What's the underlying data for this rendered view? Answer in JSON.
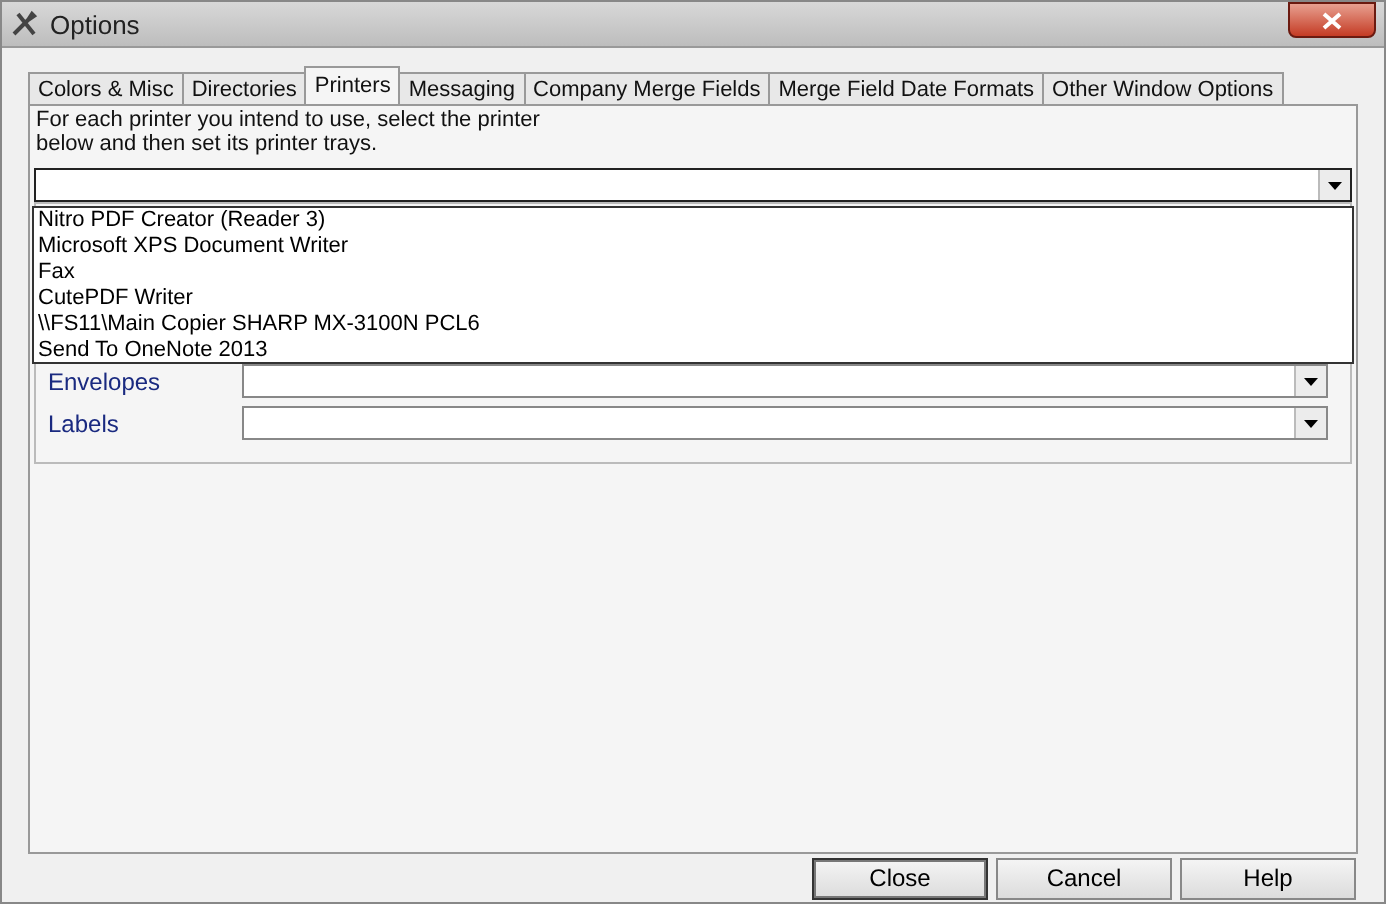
{
  "window": {
    "title": "Options"
  },
  "tabs": [
    {
      "label": "Colors & Misc",
      "selected": false
    },
    {
      "label": "Directories",
      "selected": false
    },
    {
      "label": "Printers",
      "selected": true
    },
    {
      "label": "Messaging",
      "selected": false
    },
    {
      "label": "Company Merge Fields",
      "selected": false
    },
    {
      "label": "Merge Field Date Formats",
      "selected": false
    },
    {
      "label": "Other Window Options",
      "selected": false
    }
  ],
  "instructions": "For each printer you intend to use, select the printer\nbelow and then set its printer trays.",
  "printer_dropdown": {
    "expanded": true,
    "options": [
      "Nitro PDF Creator (Reader 3)",
      "Microsoft XPS Document Writer",
      "Fax",
      "CutePDF Writer",
      "\\\\FS11\\Main Copier SHARP MX-3100N PCL6",
      "Send To OneNote 2013"
    ]
  },
  "trays": [
    {
      "label": "Envelopes"
    },
    {
      "label": "Labels"
    }
  ],
  "buttons": [
    "Close",
    "Cancel",
    "Help"
  ]
}
